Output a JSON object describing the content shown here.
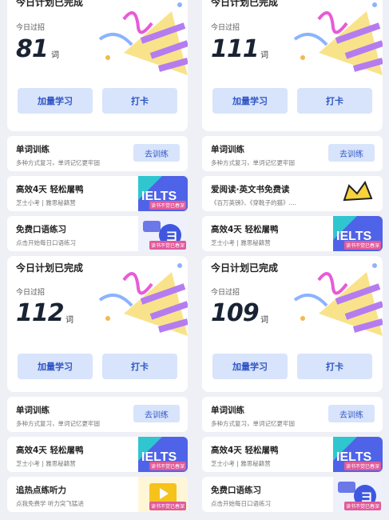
{
  "panels": [
    {
      "card": {
        "title": "今日计划已完成",
        "sub": "今日过招",
        "count": "81",
        "unit": "词",
        "btn_add": "加量学习",
        "btn_checkin": "打卡"
      },
      "rows": [
        {
          "title": "单词训练",
          "sub": "多种方式复习，单词记忆更牢固",
          "action": "去训练"
        },
        {
          "title": "高效4天 轻松屠鸭",
          "sub": "芝士小考 | 雅思秘籍营",
          "tag": "读书不觉已春深"
        },
        {
          "title": "免费口语练习",
          "sub": "点击开始每日口语练习",
          "tag": "读书不觉已春深"
        }
      ]
    },
    {
      "card": {
        "title": "今日计划已完成",
        "sub": "今日过招",
        "count": "111",
        "unit": "词",
        "btn_add": "加量学习",
        "btn_checkin": "打卡"
      },
      "rows": [
        {
          "title": "单词训练",
          "sub": "多种方式复习，单词记忆更牢固",
          "action": "去训练"
        },
        {
          "title": "爱阅读·英文书免费读",
          "sub": "《百万英镑》、《穿靴子的猫》...."
        },
        {
          "title": "高效4天 轻松屠鸭",
          "sub": "芝士小考 | 雅思秘籍营",
          "tag": "读书不觉已春深"
        }
      ]
    },
    {
      "card": {
        "title": "今日计划已完成",
        "sub": "今日过招",
        "count": "112",
        "unit": "词",
        "btn_add": "加量学习",
        "btn_checkin": "打卡"
      },
      "rows": [
        {
          "title": "单词训练",
          "sub": "多种方式复习，单词记忆更牢固",
          "action": "去训练"
        },
        {
          "title": "高效4天 轻松屠鸭",
          "sub": "芝士小考 | 雅思秘籍营",
          "tag": "读书不觉已春深"
        },
        {
          "title": "追热点练听力",
          "sub": "点我免费学 听力突飞猛进",
          "tag": "读书不觉已春深"
        }
      ]
    },
    {
      "card": {
        "title": "今日计划已完成",
        "sub": "今日过招",
        "count": "109",
        "unit": "词",
        "btn_add": "加量学习",
        "btn_checkin": "打卡"
      },
      "rows": [
        {
          "title": "单词训练",
          "sub": "多种方式复习，单词记忆更牢固",
          "action": "去训练"
        },
        {
          "title": "高效4天 轻松屠鸭",
          "sub": "芝士小考 | 雅思秘籍营",
          "tag": "读书不觉已春深"
        },
        {
          "title": "免费口语练习",
          "sub": "点击开始每日口语练习",
          "tag": "读书不觉已春深"
        }
      ]
    }
  ],
  "ielts_text": "IELTS",
  "colors": {
    "accent": "#2f55c4",
    "button_bg": "#d8e4fb",
    "page_bg": "#eef0f5"
  }
}
